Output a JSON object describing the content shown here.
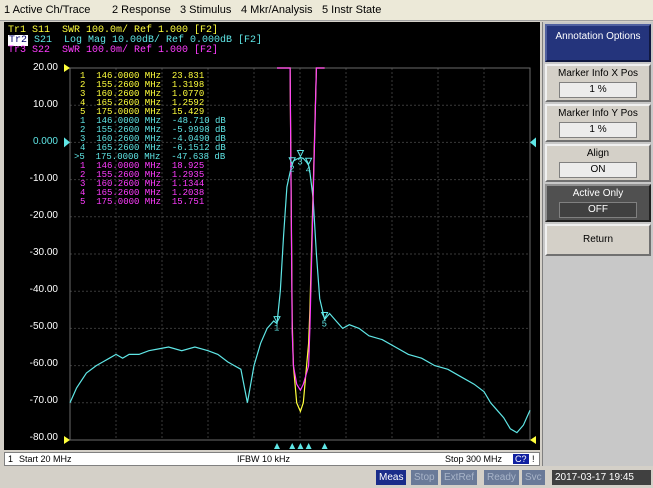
{
  "menu": [
    "1 Active Ch/Trace",
    "2 Response",
    "3 Stimulus",
    "4 Mkr/Analysis",
    "5 Instr State"
  ],
  "traces": [
    {
      "id": "Tr1",
      "label": " S11  SWR 100.0m/ Ref 1.000 [F2]",
      "color": "#ffff3c"
    },
    {
      "id": "Tr2",
      "label": " S21  Log Mag 10.00dB/ Ref 0.000dB [F2]",
      "color": "#5fe6e6"
    },
    {
      "id": "Tr3",
      "label": " S22  SWR 100.0m/ Ref 1.000 [F2]",
      "color": "#ff3cff"
    }
  ],
  "y_labels": [
    "20.00",
    "10.00",
    "0.000",
    "-10.00",
    "-20.00",
    "-30.00",
    "-40.00",
    "-50.00",
    "-60.00",
    "-70.00",
    "-80.00"
  ],
  "marker_table": [
    {
      "text": "1  146.0000 MHz  23.831",
      "color": "#ffff3c"
    },
    {
      "text": "2  155.2600 MHz  1.3198",
      "color": "#ffff3c"
    },
    {
      "text": "3  160.2600 MHz  1.0770",
      "color": "#ffff3c"
    },
    {
      "text": "4  165.2600 MHz  1.2592",
      "color": "#ffff3c"
    },
    {
      "text": "5  175.0000 MHz  15.429",
      "color": "#ffff3c"
    },
    {
      "text": "1  146.0000 MHz  -48.710 dB",
      "color": "#5fe6e6"
    },
    {
      "text": "2  155.2600 MHz  -5.9998 dB",
      "color": "#5fe6e6"
    },
    {
      "text": "3  160.2600 MHz  -4.0490 dB",
      "color": "#5fe6e6"
    },
    {
      "text": "4  165.2600 MHz  -6.1512 dB",
      "color": "#5fe6e6"
    },
    {
      "text": ">5  175.0000 MHz  -47.638 dB",
      "color": "#5fe6e6"
    },
    {
      "text": "1  146.0000 MHz  18.925",
      "color": "#ff3cff"
    },
    {
      "text": "2  155.2600 MHz  1.2935",
      "color": "#ff3cff"
    },
    {
      "text": "3  160.2600 MHz  1.1344",
      "color": "#ff3cff"
    },
    {
      "text": "4  165.2600 MHz  1.2038",
      "color": "#ff3cff"
    },
    {
      "text": "5  175.0000 MHz  15.751",
      "color": "#ff3cff"
    }
  ],
  "status": {
    "channel": "1",
    "start": "Start 20 MHz",
    "ifbw": "IFBW 10 kHz",
    "stop": "Stop 300 MHz",
    "cal": "C?",
    "sep": "!"
  },
  "bottom_bar": {
    "meas": "Meas",
    "stop": "Stop",
    "extref": "ExtRef",
    "ready": "Ready",
    "svc": "Svc",
    "datetime": "2017-03-17 19:45"
  },
  "softkeys": {
    "title": "Annotation Options",
    "marker_x_label": "Marker Info X Pos",
    "marker_x_value": "1 %",
    "marker_y_label": "Marker Info Y Pos",
    "marker_y_value": "1 %",
    "align_label": "Align",
    "align_value": "ON",
    "active_only_label": "Active Only",
    "active_only_value": "OFF",
    "return_label": "Return"
  },
  "chart_data": {
    "type": "line",
    "x_unit": "MHz",
    "xlim": [
      20,
      300
    ],
    "ylim": [
      -80,
      20
    ],
    "ylabel_unit": "dB",
    "grid": true,
    "series": [
      {
        "name": "S21",
        "color": "#5fe6e6",
        "x": [
          20,
          24,
          30,
          36,
          40,
          44,
          48,
          52,
          56,
          62,
          68,
          74,
          80,
          88,
          96,
          104,
          110,
          116,
          120,
          124,
          128,
          132,
          136,
          140,
          144,
          146,
          148,
          150,
          152,
          154,
          155.26,
          156,
          158,
          160.26,
          162,
          164,
          165.26,
          166,
          168,
          170,
          172,
          175,
          178,
          182,
          186,
          190,
          196,
          202,
          210,
          218,
          226,
          234,
          242,
          250,
          258,
          266,
          272,
          276,
          280,
          284,
          288,
          292,
          296,
          300
        ],
        "y": [
          -70,
          -66,
          -62,
          -60,
          -59,
          -58,
          -57,
          -58,
          -57,
          -57,
          -56,
          -55.5,
          -55,
          -56,
          -55,
          -56,
          -57,
          -59,
          -60,
          -61,
          -70,
          -60,
          -54,
          -50,
          -48,
          -48.7,
          -40,
          -25,
          -12,
          -8,
          -6.0,
          -5,
          -4.5,
          -4.05,
          -4.3,
          -5.3,
          -6.15,
          -8,
          -15,
          -30,
          -42,
          -47.6,
          -46,
          -48,
          -50,
          -49,
          -50,
          -52,
          -53,
          -55,
          -57,
          -58,
          -60,
          -61,
          -63,
          -65,
          -67,
          -70,
          -72,
          -74,
          -77,
          -78,
          -76,
          -72
        ]
      },
      {
        "name": "S11",
        "color": "#ffff3c",
        "x": [
          146,
          150,
          154,
          155.26,
          156,
          158,
          160.26,
          162,
          164,
          165.26,
          166,
          170,
          175
        ],
        "y": [
          23.8,
          18,
          3.1,
          1.32,
          1.2,
          1.1,
          1.077,
          1.1,
          1.2,
          1.26,
          1.35,
          8,
          15.4
        ]
      },
      {
        "name": "S22",
        "color": "#ff3cff",
        "x": [
          146,
          150,
          154,
          155.26,
          156,
          158,
          160.26,
          162,
          164,
          165.26,
          166,
          170,
          175
        ],
        "y": [
          18.9,
          14,
          2.8,
          1.29,
          1.2,
          1.15,
          1.134,
          1.15,
          1.18,
          1.2,
          1.3,
          7,
          15.8
        ]
      }
    ],
    "markers": [
      {
        "n": "1",
        "x": 146
      },
      {
        "n": "2",
        "x": 155.26
      },
      {
        "n": "3",
        "x": 160.26
      },
      {
        "n": "4",
        "x": 165.26
      },
      {
        "n": "5",
        "x": 175
      }
    ]
  }
}
